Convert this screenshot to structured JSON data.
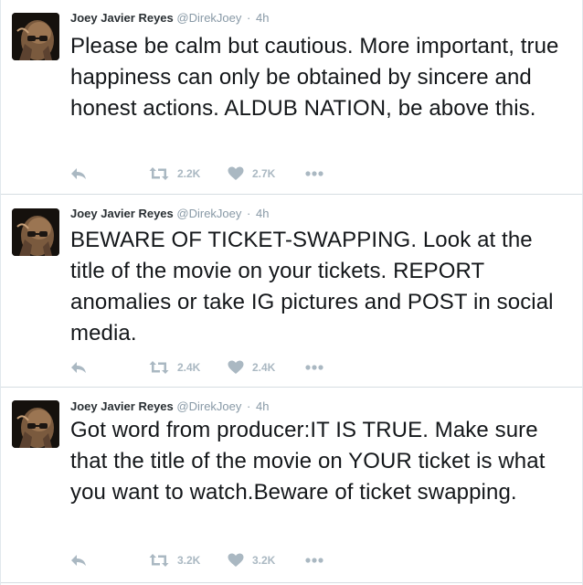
{
  "tweets": [
    {
      "fullname": "Joey Javier Reyes",
      "handle": "@DirekJoey",
      "separator": "·",
      "time": "4h",
      "text": "Please be calm but cautious. More important, true happiness can only be obtained by sincere and honest actions. ALDUB NATION, be above this.",
      "retweets": "2.2K",
      "likes": "2.7K"
    },
    {
      "fullname": "Joey Javier Reyes",
      "handle": "@DirekJoey",
      "separator": "·",
      "time": "4h",
      "text": "BEWARE OF TICKET-SWAPPING. Look at the title of the movie on your tickets. REPORT anomalies or take IG pictures and POST in social media.",
      "retweets": "2.4K",
      "likes": "2.4K"
    },
    {
      "fullname": "Joey Javier Reyes",
      "handle": "@DirekJoey",
      "separator": "·",
      "time": "4h",
      "text": "Got word from producer:IT IS TRUE. Make sure that the title of the movie on YOUR ticket is what you want to watch.Beware of ticket swapping.",
      "retweets": "3.2K",
      "likes": "3.2K"
    }
  ],
  "icons": {
    "reply": "reply-icon",
    "retweet": "retweet-icon",
    "like": "heart-icon",
    "more": "more-icon"
  },
  "colors": {
    "text": "#14171a",
    "name": "#292f33",
    "muted": "#8899a6",
    "action": "#aab8c2",
    "divider": "#d6dde2"
  }
}
